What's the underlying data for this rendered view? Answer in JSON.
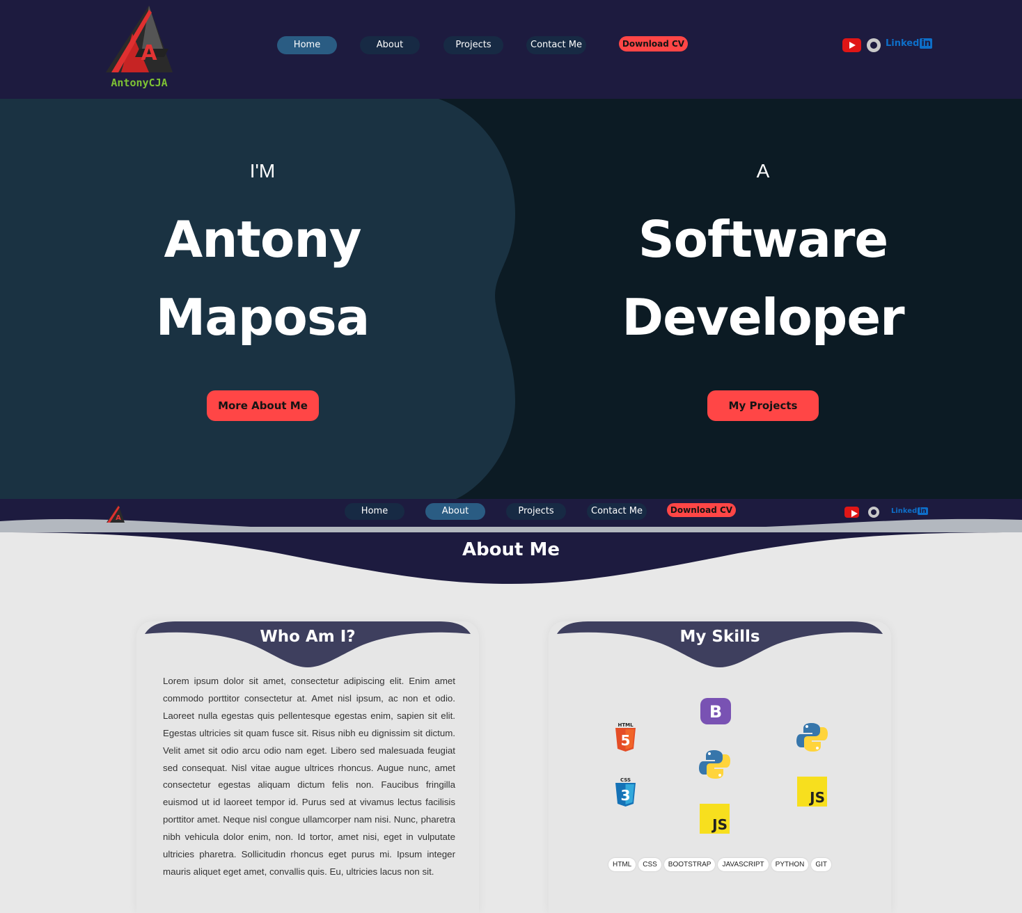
{
  "brand": {
    "logo_text": "AntonyCJA"
  },
  "nav": {
    "items": [
      {
        "label": "Home"
      },
      {
        "label": "About"
      },
      {
        "label": "Projects"
      },
      {
        "label": "Contact Me"
      }
    ],
    "download_cv": "Download CV"
  },
  "social": {
    "linkedin_word": "Linked",
    "linkedin_box": "in"
  },
  "hero": {
    "left_intro": "I'M",
    "left_line1": "Antony",
    "left_line2": "Maposa",
    "left_button": "More About Me",
    "right_intro": "A",
    "right_line1": "Software",
    "right_line2": "Developer",
    "right_button": "My Projects"
  },
  "about": {
    "title": "About Me",
    "who_title": "Who Am I?",
    "who_text": "Lorem ipsum dolor sit amet, consectetur adipiscing elit. Enim amet commodo porttitor consectetur at. Amet nisl ipsum, ac non et odio. Laoreet nulla egestas quis pellentesque egestas enim, sapien sit elit. Egestas ultricies sit quam fusce sit. Risus nibh eu dignissim sit dictum. Velit amet sit odio arcu odio nam eget. Libero sed malesuada feugiat sed consequat. Nisl vitae augue ultrices rhoncus. Augue nunc, amet consectetur egestas aliquam dictum felis non. Faucibus fringilla euismod ut id laoreet tempor id. Purus sed at vivamus lectus facilisis porttitor amet. Neque nisl congue ullamcorper nam nisi. Nunc, pharetra nibh vehicula dolor enim, non. Id tortor, amet nisi, eget in vulputate ultricies pharetra. Sollicitudin rhoncus eget purus mi. Ipsum integer mauris aliquet eget amet, convallis quis. Eu, ultricies lacus non sit.",
    "skills_title": "My Skills",
    "skill_icons": {
      "html_label": "HTML",
      "html_glyph": "5",
      "css_label": "CSS",
      "css_glyph": "3",
      "bootstrap_glyph": "B",
      "js_glyph": "JS"
    },
    "skill_tags": [
      "HTML",
      "CSS",
      "BOOTSTRAP",
      "JAVASCRIPT",
      "PYTHON",
      "GIT"
    ]
  },
  "colors": {
    "navy": "#1d1b3f",
    "hero_left": "#1a3242",
    "hero_right": "#0c1b24",
    "accent_red": "#ff4646",
    "active_pill": "#2a5c83",
    "pill": "#172a44",
    "page_bg": "#e8e8e8"
  }
}
